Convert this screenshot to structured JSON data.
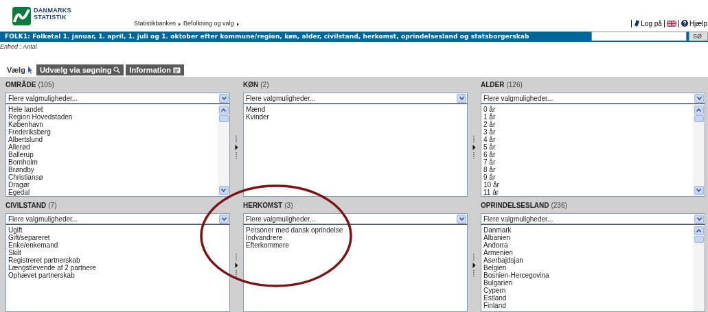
{
  "logo": {
    "lines": [
      "DANMARKS",
      "STATISTIK"
    ]
  },
  "breadcrumb": [
    "Statistikbanken",
    "Befolkning og valg"
  ],
  "top_links": [
    {
      "kind": "login",
      "label": "Log på"
    },
    {
      "kind": "flag"
    },
    {
      "kind": "help",
      "label": "Hjælp"
    }
  ],
  "title_bar": {
    "title": "FOLK1: Folketal 1. januar, 1. april, 1. juli og 1. oktober efter kommune/region, køn, alder, civilstand, herkomst, oprindelsesland og statsborgerskab",
    "search_button": "SØ"
  },
  "unit": "Enhed : Antal",
  "tabs": [
    {
      "label": "Vælg",
      "kind": "cursor",
      "selected": true
    },
    {
      "label": "Udvælg via søgning",
      "kind": "search",
      "selected": false
    },
    {
      "label": "Information",
      "kind": "info",
      "selected": false
    }
  ],
  "panels": [
    {
      "name": "OMRÅDE",
      "count": "(105)",
      "select": "Flere valgmuligheder...",
      "scrollable": true,
      "items": [
        "Hele landet",
        "Region Hovedstaden",
        "København",
        "Frederiksberg",
        "Albertslund",
        "Allerød",
        "Ballerup",
        "Bornholm",
        "Brøndby",
        "Christiansø",
        "Dragør",
        "Egedal"
      ]
    },
    {
      "name": "KØN",
      "count": "(2)",
      "select": "Flere valgmuligheder...",
      "scrollable": false,
      "items": [
        "Mænd",
        "Kvinder"
      ]
    },
    {
      "name": "ALDER",
      "count": "(126)",
      "select": "Flere valgmuligheder...",
      "scrollable": true,
      "items": [
        "0 år",
        "1 år",
        "2 år",
        "3 år",
        "4 år",
        "5 år",
        "6 år",
        "7 år",
        "8 år",
        "9 år",
        "10 år",
        "11 år"
      ]
    },
    {
      "name": "CIVILSTAND",
      "count": "(7)",
      "select": "Flere valgmuligheder...",
      "scrollable": false,
      "items": [
        "Ugift",
        "Gift/separeret",
        "Enke/enkemand",
        "Skilt",
        "Registreret partnerskab",
        "Længstlevende af 2 partnere",
        "Ophævet partnerskab"
      ]
    },
    {
      "name": "HERKOMST",
      "count": "(3)",
      "select": "Flere valgmuligheder...",
      "scrollable": false,
      "items": [
        "Personer med dansk oprindelse",
        "Indvandrere",
        "Efterkommere"
      ]
    },
    {
      "name": "OPRINDELSESLAND",
      "count": "(236)",
      "select": "Flere valgmuligheder...",
      "scrollable": true,
      "items": [
        "Danmark",
        "Albanien",
        "Andorra",
        "Armenien",
        "Aserbajdsjan",
        "Belgien",
        "Bosnien-Hercegovina",
        "Bulgarien",
        "Cypern",
        "Estland",
        "Finland"
      ]
    }
  ],
  "annotation": {
    "kind": "ellipse"
  }
}
